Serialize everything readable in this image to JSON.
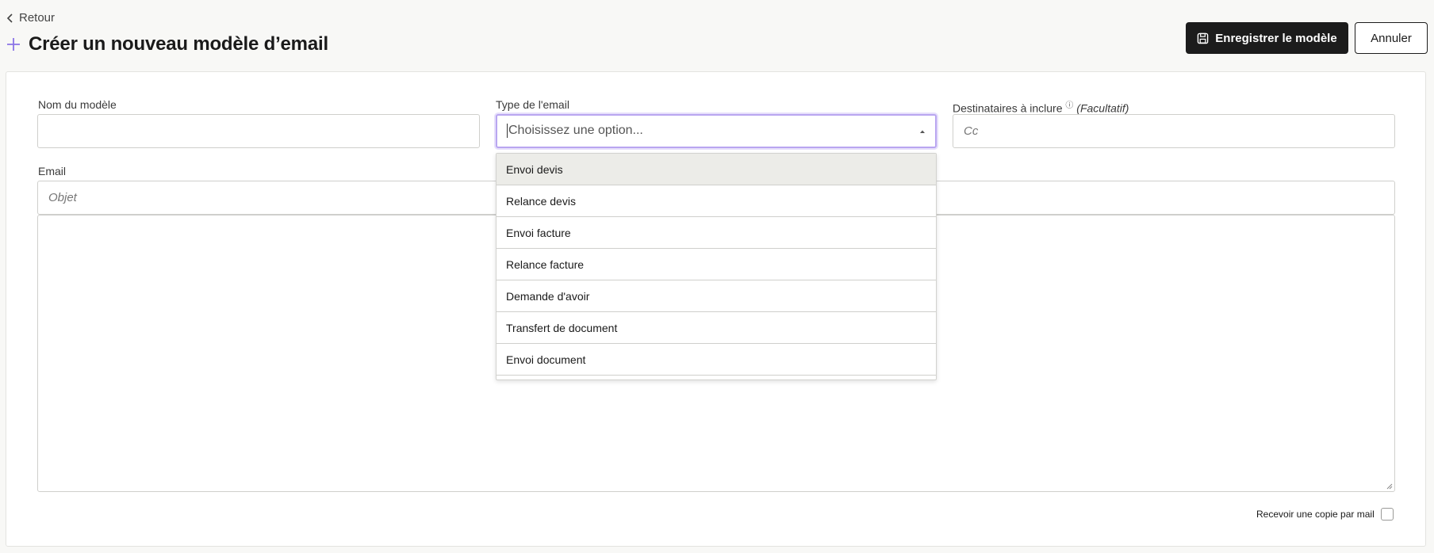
{
  "header": {
    "back_label": "Retour",
    "title": "Créer un nouveau modèle d’email",
    "save_label": "Enregistrer le modèle",
    "cancel_label": "Annuler"
  },
  "form": {
    "template_name": {
      "label": "Nom du modèle",
      "value": ""
    },
    "email_type": {
      "label": "Type de l'email",
      "placeholder": "Choisissez une option...",
      "options": [
        "Envoi devis",
        "Relance devis",
        "Envoi facture",
        "Relance facture",
        "Demande d'avoir",
        "Transfert de document",
        "Envoi document"
      ],
      "highlighted_index": 0
    },
    "recipients": {
      "label": "Destinataires à inclure",
      "optional": "(Facultatif)",
      "placeholder": "Cc"
    },
    "email": {
      "label": "Email",
      "subject_placeholder": "Objet",
      "body": ""
    },
    "copy_checkbox": {
      "label": "Recevoir une copie par mail",
      "checked": false
    }
  },
  "colors": {
    "primary_button": "#1c1c1c",
    "focus_ring": "#b9a6f0",
    "accent_plus": "#8b74e6",
    "page_bg": "#f8f8f6"
  }
}
